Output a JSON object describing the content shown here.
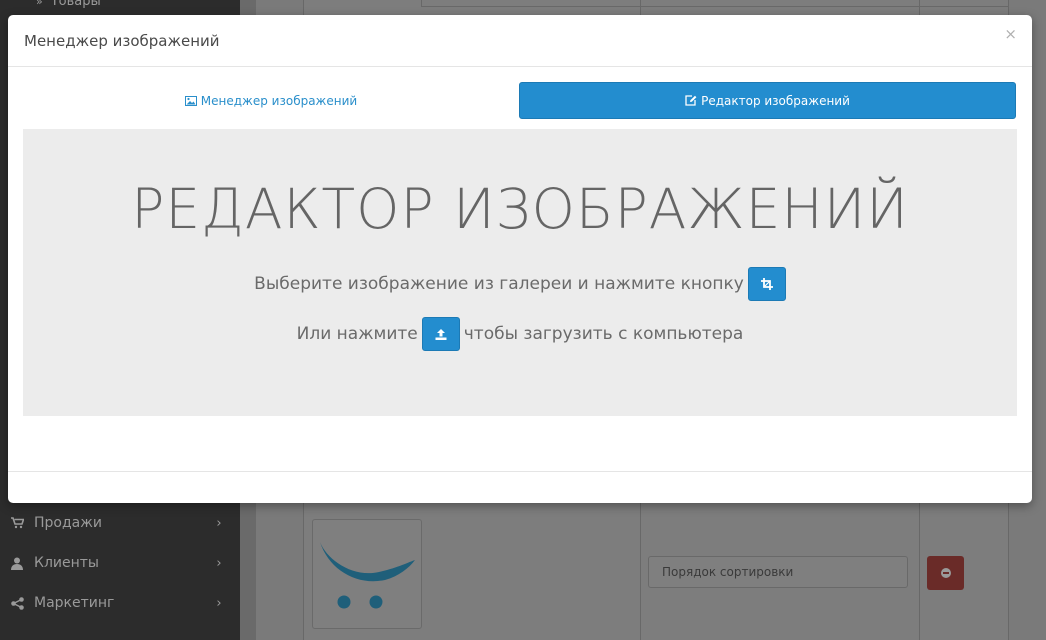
{
  "sidebar": {
    "top_item": "Товары",
    "items": [
      {
        "label": "Продажи",
        "icon": "cart-icon"
      },
      {
        "label": "Клиенты",
        "icon": "user-icon"
      },
      {
        "label": "Маркетинг",
        "icon": "share-icon"
      }
    ]
  },
  "background": {
    "sort_placeholder": "Порядок сортировки"
  },
  "modal": {
    "title": "Менеджер изображений",
    "close": "×",
    "tabs": [
      {
        "label": "Менеджер изображений",
        "icon": "image-icon",
        "active": false
      },
      {
        "label": "Редактор изображений",
        "icon": "edit-icon",
        "active": true
      }
    ],
    "editor": {
      "heading": "РЕДАКТОР ИЗОБРАЖЕНИЙ",
      "line1": "Выберите изображение из галереи и нажмите кнопку",
      "line2_before": "Или нажмите",
      "line2_after": "чтобы загрузить с компьютера"
    }
  },
  "colors": {
    "accent": "#238dcf",
    "danger": "#c9302c",
    "sidebar_bg": "#2c2c2c"
  }
}
